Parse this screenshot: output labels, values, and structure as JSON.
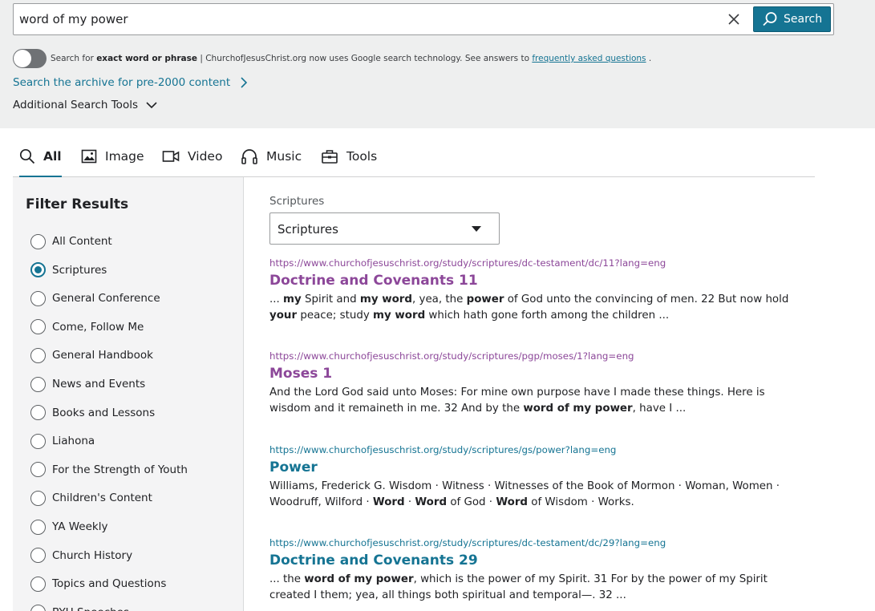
{
  "search": {
    "query": "word of my power",
    "button_label": "Search"
  },
  "exact": {
    "pre": "Search for ",
    "bold": "exact word or phrase",
    "mid": " | ChurchofJesusChrist.org now uses Google search technology. See answers to ",
    "link": "frequently asked questions",
    "post": " ."
  },
  "archive_link": "Search the archive for pre-2000 content",
  "additional_tools": "Additional Search Tools",
  "tabs": [
    {
      "label": "All",
      "icon": "search-icon"
    },
    {
      "label": "Image",
      "icon": "image-icon"
    },
    {
      "label": "Video",
      "icon": "video-icon"
    },
    {
      "label": "Music",
      "icon": "headphones-icon"
    },
    {
      "label": "Tools",
      "icon": "toolbox-icon"
    }
  ],
  "filters": {
    "title": "Filter Results",
    "items": [
      {
        "label": "All Content",
        "checked": false
      },
      {
        "label": "Scriptures",
        "checked": true
      },
      {
        "label": "General Conference",
        "checked": false
      },
      {
        "label": "Come, Follow Me",
        "checked": false
      },
      {
        "label": "General Handbook",
        "checked": false
      },
      {
        "label": "News and Events",
        "checked": false
      },
      {
        "label": "Books and Lessons",
        "checked": false
      },
      {
        "label": "Liahona",
        "checked": false
      },
      {
        "label": "For the Strength of Youth",
        "checked": false
      },
      {
        "label": "Children's Content",
        "checked": false
      },
      {
        "label": "YA Weekly",
        "checked": false
      },
      {
        "label": "Church History",
        "checked": false
      },
      {
        "label": "Topics and Questions",
        "checked": false
      },
      {
        "label": "BYU Speeches",
        "checked": false
      }
    ]
  },
  "collection": {
    "label": "Scriptures",
    "selected": "Scriptures"
  },
  "results": [
    {
      "url": "https://www.churchofjesuschrist.org/study/scriptures/dc-testament/dc/11?lang=eng",
      "title": "Doctrine and Covenants 11",
      "visited": true,
      "snippet": [
        {
          "t": "... ",
          "b": false
        },
        {
          "t": "my",
          "b": true
        },
        {
          "t": " Spirit and ",
          "b": false
        },
        {
          "t": "my word",
          "b": true
        },
        {
          "t": ", yea, the ",
          "b": false
        },
        {
          "t": "power",
          "b": true
        },
        {
          "t": " of God unto the convincing of men. 22 But now hold ",
          "b": false
        },
        {
          "t": "your",
          "b": true
        },
        {
          "t": " peace; study ",
          "b": false
        },
        {
          "t": "my word",
          "b": true
        },
        {
          "t": " which hath gone forth among the children ...",
          "b": false
        }
      ]
    },
    {
      "url": "https://www.churchofjesuschrist.org/study/scriptures/pgp/moses/1?lang=eng",
      "title": "Moses 1",
      "visited": true,
      "snippet": [
        {
          "t": "And the Lord God said unto Moses: For mine own purpose have I made these things. Here is wisdom and it remaineth in me. 32 And by the ",
          "b": false
        },
        {
          "t": "word of my power",
          "b": true
        },
        {
          "t": ", have I ...",
          "b": false
        }
      ]
    },
    {
      "url": "https://www.churchofjesuschrist.org/study/scriptures/gs/power?lang=eng",
      "title": "Power",
      "visited": false,
      "snippet": [
        {
          "t": "Williams, Frederick G. Wisdom · Witness · Witnesses of the Book of Mormon · Woman, Women · Woodruff, Wilford · ",
          "b": false
        },
        {
          "t": "Word",
          "b": true
        },
        {
          "t": " · ",
          "b": false
        },
        {
          "t": "Word",
          "b": true
        },
        {
          "t": " of God · ",
          "b": false
        },
        {
          "t": "Word",
          "b": true
        },
        {
          "t": " of Wisdom · Works.",
          "b": false
        }
      ]
    },
    {
      "url": "https://www.churchofjesuschrist.org/study/scriptures/dc-testament/dc/29?lang=eng",
      "title": "Doctrine and Covenants 29",
      "visited": false,
      "snippet": [
        {
          "t": "... the ",
          "b": false
        },
        {
          "t": "word of my power",
          "b": true
        },
        {
          "t": ", which is the power of my Spirit. 31 For by the power of my Spirit created I them; yea, all things both spiritual and temporal—. 32 ...",
          "b": false
        }
      ]
    }
  ],
  "colors": {
    "accent": "#157493",
    "visited": "#8c4799",
    "band": "#eeefef"
  }
}
